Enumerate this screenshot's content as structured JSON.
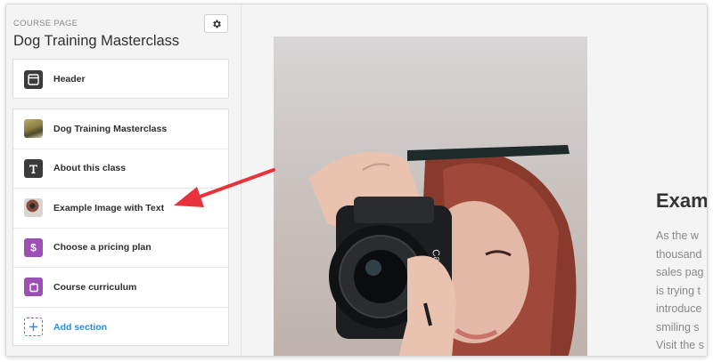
{
  "sidebar": {
    "crumb": "COURSE PAGE",
    "title": "Dog Training Masterclass",
    "header_item": {
      "label": "Header",
      "icon": "header-layout-icon"
    },
    "sections": [
      {
        "label": "Dog Training Masterclass",
        "icon": "dog-thumbnail"
      },
      {
        "label": "About this class",
        "icon": "text-t-icon"
      },
      {
        "label": "Example Image with Text",
        "icon": "photo-thumbnail"
      },
      {
        "label": "Choose a pricing plan",
        "icon": "dollar-icon"
      },
      {
        "label": "Course curriculum",
        "icon": "curriculum-icon"
      },
      {
        "label": "Add section",
        "icon": "plus-icon"
      }
    ]
  },
  "preview": {
    "heading": "Examp",
    "body_lines": [
      "As the w",
      "thousand",
      "sales pag",
      "is trying t",
      "introduce",
      "smiling s",
      "Visit the s"
    ]
  },
  "colors": {
    "accent": "#2b8fd4",
    "purple": "#9c4fb4",
    "arrow": "#e8323c"
  }
}
